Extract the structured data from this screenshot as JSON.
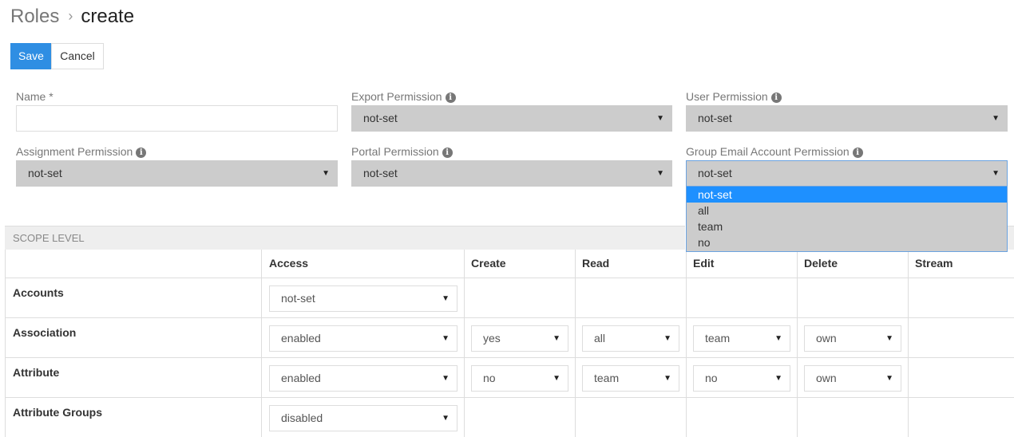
{
  "breadcrumb": {
    "parent": "Roles",
    "separator": "›",
    "current": "create"
  },
  "buttons": {
    "save": "Save",
    "cancel": "Cancel"
  },
  "form": {
    "name_label": "Name *",
    "name_value": "",
    "export_label": "Export Permission",
    "export_value": "not-set",
    "user_label": "User Permission",
    "user_value": "not-set",
    "assignment_label": "Assignment Permission",
    "assignment_value": "not-set",
    "portal_label": "Portal Permission",
    "portal_value": "not-set",
    "group_email_label": "Group Email Account Permission",
    "group_email_value": "not-set"
  },
  "dropdown_options": [
    "not-set",
    "all",
    "team",
    "no"
  ],
  "scope": {
    "header": "SCOPE LEVEL",
    "columns": [
      "Access",
      "Create",
      "Read",
      "Edit",
      "Delete",
      "Stream"
    ],
    "rows": [
      {
        "name": "Accounts",
        "access": "not-set"
      },
      {
        "name": "Association",
        "access": "enabled",
        "create": "yes",
        "read": "all",
        "edit": "team",
        "delete": "own"
      },
      {
        "name": "Attribute",
        "access": "enabled",
        "create": "no",
        "read": "team",
        "edit": "no",
        "delete": "own"
      },
      {
        "name": "Attribute Groups",
        "access": "disabled"
      }
    ]
  },
  "icons": {
    "info": "info-circle-icon",
    "caret": "caret-down-icon"
  },
  "colors": {
    "primary": "#2f8ee3",
    "selected_option": "#1e90ff",
    "select_bg": "#cccccc"
  }
}
